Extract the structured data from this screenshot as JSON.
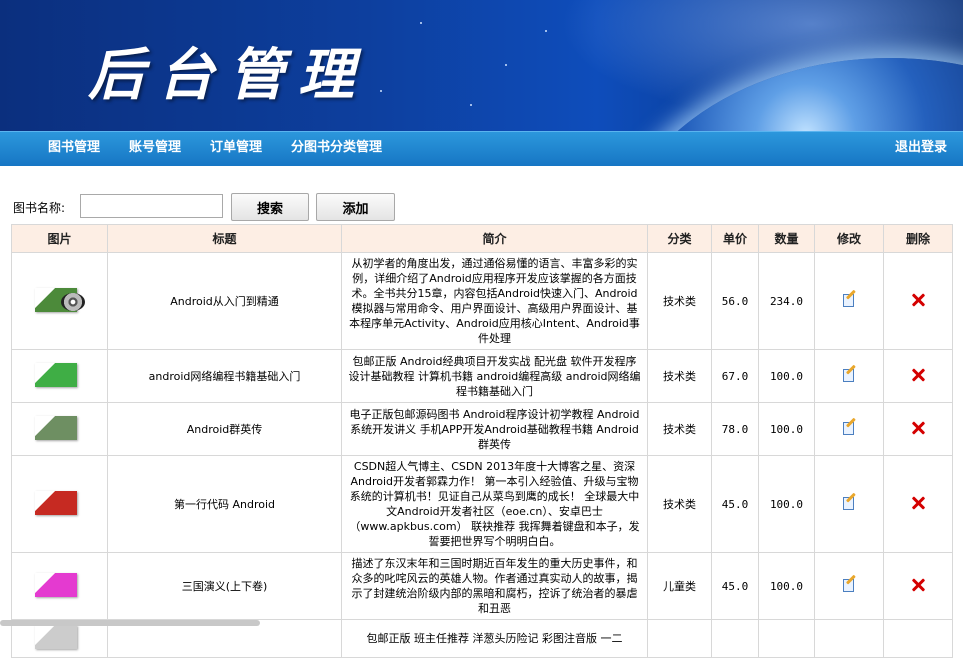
{
  "header": {
    "title": "后台管理"
  },
  "nav": {
    "items": [
      {
        "label": "图书管理"
      },
      {
        "label": "账号管理"
      },
      {
        "label": "订单管理"
      },
      {
        "label": "分图书分类管理"
      }
    ],
    "logout_label": "退出登录"
  },
  "search": {
    "label": "图书名称:",
    "value": "",
    "placeholder": "",
    "search_button": "搜索",
    "add_button": "添加"
  },
  "table": {
    "columns": [
      "图片",
      "标题",
      "简介",
      "分类",
      "单价",
      "数量",
      "修改",
      "删除"
    ],
    "rows": [
      {
        "title": "Android从入门到精通",
        "description": "从初学者的角度出发，通过通俗易懂的语言、丰富多彩的实例，详细介绍了Android应用程序开发应该掌握的各方面技术。全书共分15章，内容包括Android快速入门、Android模拟器与常用命令、用户界面设计、高级用户界面设计、基本程序单元Activity、Android应用核心Intent、Android事件处理",
        "category": "技术类",
        "price": "56.0",
        "quantity": "234.0",
        "cover_color": "#4c8a3a"
      },
      {
        "title": "android网络编程书籍基础入门",
        "description": "包邮正版 Android经典项目开发实战 配光盘 软件开发程序设计基础教程 计算机书籍 android编程高级 android网络编程书籍基础入门",
        "category": "技术类",
        "price": "67.0",
        "quantity": "100.0",
        "cover_color": "#3fae45"
      },
      {
        "title": "Android群英传",
        "description": "电子正版包邮源码图书 Android程序设计初学教程 Android系统开发讲义 手机APP开发Android基础教程书籍 Android群英传",
        "category": "技术类",
        "price": "78.0",
        "quantity": "100.0",
        "cover_color": "#6e8f62"
      },
      {
        "title": "第一行代码 Android",
        "description": "CSDN超人气博主、CSDN 2013年度十大博客之星、资深Android开发者郭霖力作！ 第一本引入经验值、升级与宝物系统的计算机书！见证自己从菜鸟到鹰的成长！ 全球最大中文Android开发者社区（eoe.cn）、安卓巴士（www.apkbus.com） 联袂推荐 我挥舞着键盘和本子，发誓要把世界写个明明白白。",
        "category": "技术类",
        "price": "45.0",
        "quantity": "100.0",
        "cover_color": "#c62a22"
      },
      {
        "title": "三国演义(上下卷)",
        "description": "描述了东汉末年和三国时期近百年发生的重大历史事件，和众多的叱咤风云的英雄人物。作者通过真实动人的故事，揭示了封建统治阶级内部的黑暗和腐朽，控诉了统治者的暴虐和丑恶",
        "category": "儿童类",
        "price": "45.0",
        "quantity": "100.0",
        "cover_color": "#e43ad0"
      },
      {
        "title": "",
        "description": "包邮正版 班主任推荐 洋葱头历险记 彩图注音版 一二",
        "category": "",
        "price": "",
        "quantity": "",
        "cover_color": "#cccccc"
      }
    ]
  }
}
